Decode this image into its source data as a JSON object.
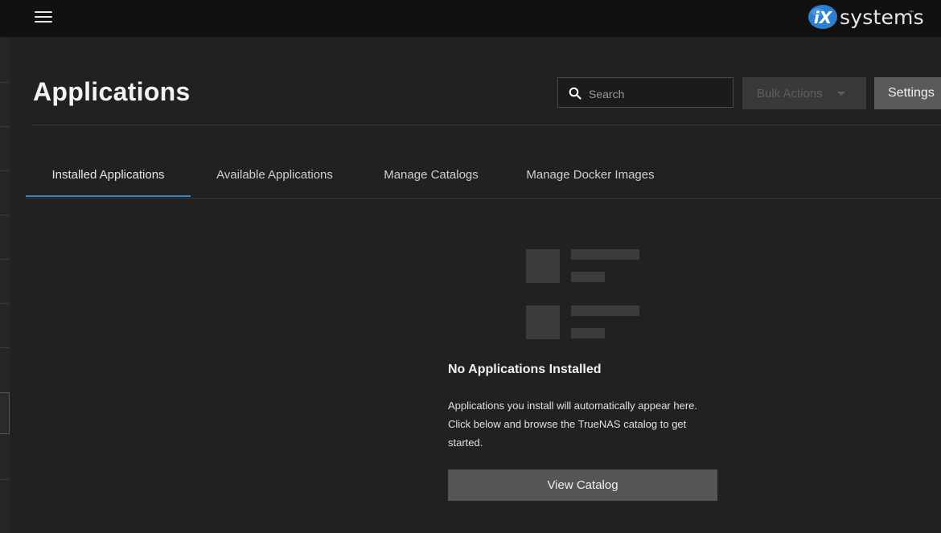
{
  "topbar": {
    "menu_icon": "hamburger-menu-icon",
    "logo": {
      "mark": "iX",
      "text": "systems",
      "tm": "™"
    }
  },
  "page": {
    "title": "Applications"
  },
  "toolbar": {
    "search_placeholder": "Search",
    "search_value": "",
    "search_icon": "search-icon",
    "bulk_actions_label": "Bulk Actions",
    "bulk_actions_disabled": true,
    "settings_label": "Settings"
  },
  "tabs": [
    {
      "label": "Installed Applications",
      "active": true
    },
    {
      "label": "Available Applications",
      "active": false
    },
    {
      "label": "Manage Catalogs",
      "active": false
    },
    {
      "label": "Manage Docker Images",
      "active": false
    }
  ],
  "empty_state": {
    "icon": "empty-list-icon",
    "title": "No Applications Installed",
    "message": "Applications you install will automatically appear here. Click below and browse the TrueNAS catalog to get started.",
    "button_label": "View Catalog"
  },
  "colors": {
    "background": "#212121",
    "topbar": "#111111",
    "accent": "#3a86c8",
    "logo_blue": "#2f7fd0"
  }
}
